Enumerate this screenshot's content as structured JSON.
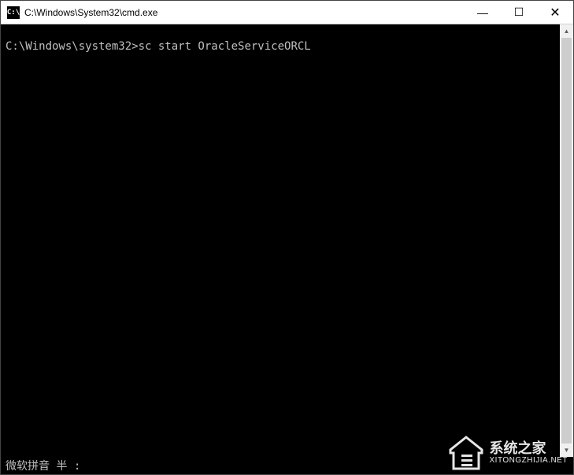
{
  "window": {
    "title": "C:\\Windows\\System32\\cmd.exe",
    "icon_label": "C:\\"
  },
  "titlebar_controls": {
    "minimize": "—",
    "maximize": "☐",
    "close": "✕"
  },
  "terminal": {
    "prompt": "C:\\Windows\\system32>",
    "command": "sc start OracleServiceORCL"
  },
  "ime": {
    "status": "微软拼音 半 :"
  },
  "scrollbar": {
    "up": "▲",
    "down": "▼"
  },
  "watermark": {
    "title": "系统之家",
    "subtitle": "XITONGZHIJIA.NET"
  }
}
